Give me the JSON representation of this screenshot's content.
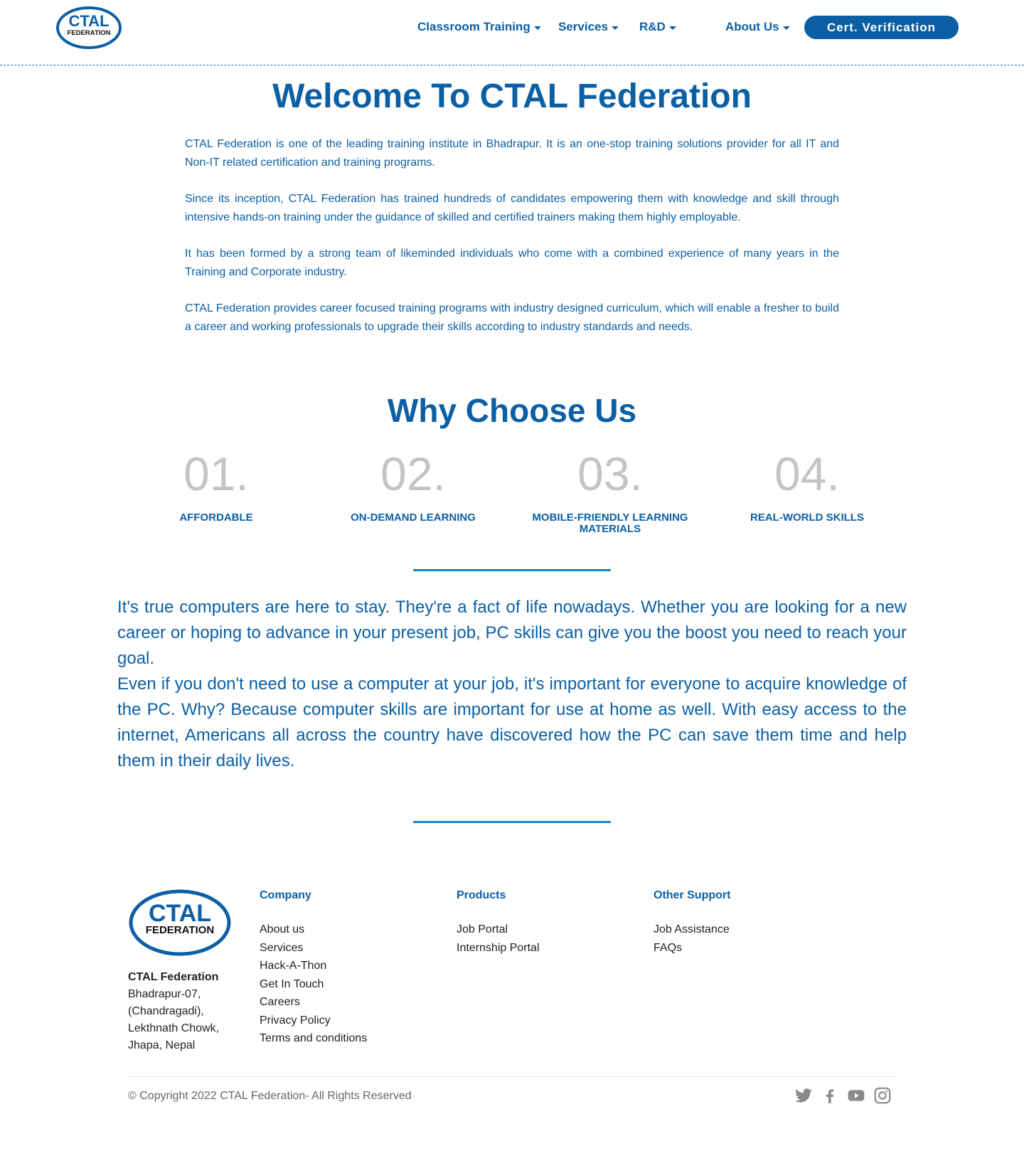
{
  "colors": {
    "brand": "#0b5fa5",
    "accent": "#1b86c8",
    "feature_number": "#c4c4c4"
  },
  "header": {
    "logo_text": {
      "top": "CTAL",
      "bottom": "FEDERATION"
    },
    "nav": {
      "classroom_training": "Classroom Training",
      "services": "Services",
      "rd": "R&D",
      "about_us": "About Us"
    },
    "cert_button": "Cert. Verification"
  },
  "welcome": {
    "title": "Welcome To CTAL Federation",
    "paragraphs": [
      "CTAL Federation is one of the leading training institute in Bhadrapur. It is an one-stop training solutions provider for all IT and Non-IT related certification and training programs.",
      "Since its inception, CTAL Federation has trained hundreds of candidates empowering them with knowledge and skill through intensive hands-on training under the guidance of skilled and certified trainers making them highly employable.",
      "It has been formed by a strong team of likeminded individuals who come with a combined experience of many years in the Training and Corporate industry.",
      "CTAL Federation provides career focused training programs with industry designed curriculum, which will enable a fresher to build a career and working professionals to upgrade their skills according to industry standards and needs."
    ]
  },
  "why": {
    "title": "Why Choose Us",
    "features": [
      {
        "number": "01.",
        "label": "AFFORDABLE"
      },
      {
        "number": "02.",
        "label": "ON-DEMAND LEARNING"
      },
      {
        "number": "03.",
        "label": "MOBILE-FRIENDLY LEARNING MATERIALS"
      },
      {
        "number": "04.",
        "label": "REAL-WORLD SKILLS"
      }
    ],
    "body": [
      "It's true computers are here to stay. They're a fact of life nowadays. Whether you are looking for a new career or hoping to advance in your present job, PC skills can give you the boost you need to reach your goal.",
      "Even if you don't need to use a computer at your job, it's important for everyone to acquire knowledge of the PC. Why? Because computer skills are important for use at home as well. With easy access to the internet, Americans all across the country have discovered how the PC can save them time and help them in their daily lives."
    ]
  },
  "footer": {
    "company_name": "CTAL Federation",
    "address": [
      "Bhadrapur-07,",
      "(Chandragadi),",
      "Lekthnath Chowk,",
      "Jhapa, Nepal"
    ],
    "columns": [
      {
        "title": "Company",
        "links": [
          "About us",
          "Services",
          "Hack-A-Thon",
          "Get In Touch",
          "Careers",
          "Privacy Policy",
          "Terms and conditions"
        ]
      },
      {
        "title": "Products",
        "links": [
          "Job Portal",
          "Internship Portal"
        ]
      },
      {
        "title": "Other Support",
        "links": [
          "Job Assistance",
          "FAQs"
        ]
      }
    ],
    "copyright": "© Copyright 2022 CTAL Federation- All Rights Reserved",
    "social_icons": [
      "twitter-icon",
      "facebook-icon",
      "youtube-icon",
      "instagram-icon"
    ]
  }
}
